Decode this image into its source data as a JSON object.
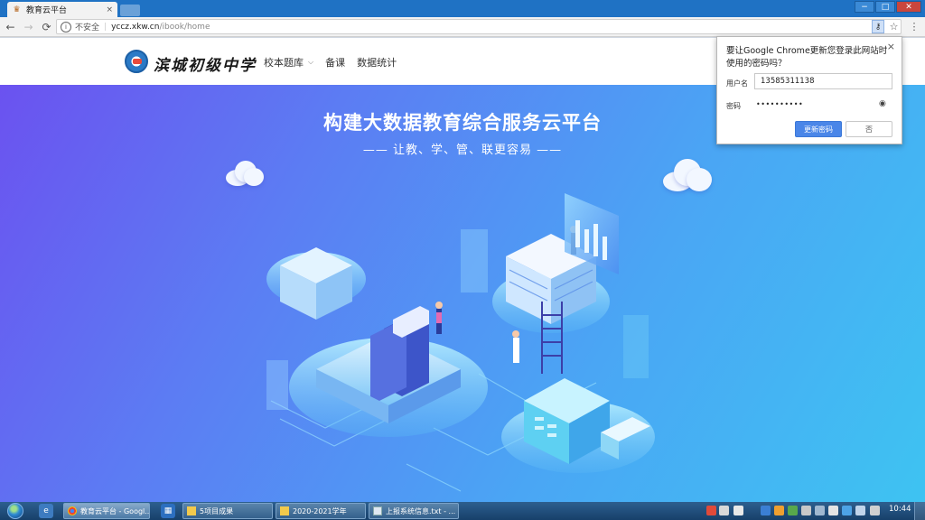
{
  "browser": {
    "tab_title": "教育云平台",
    "tab_close": "×",
    "window_controls": {
      "minimize": "−",
      "maximize": "□",
      "close": "✕"
    },
    "nav": {
      "back": "←",
      "forward": "→",
      "reload": "⟳"
    },
    "address": {
      "security_label": "不安全",
      "host": "yccz.xkw.cn",
      "path": "/ibook/home"
    }
  },
  "site": {
    "school_name": "滨城初级中学",
    "nav_items": [
      {
        "label": "校本题库",
        "has_dropdown": true
      },
      {
        "label": "备课"
      },
      {
        "label": "数据统计"
      }
    ]
  },
  "hero": {
    "title": "构建大数据教育综合服务云平台",
    "subtitle": "—— 让教、学、管、联更容易 ——"
  },
  "password_popup": {
    "title": "要让Google Chrome更新您登录此网站时使用的密码吗？",
    "username_label": "用户名",
    "username_value": "13585311138",
    "password_label": "密码",
    "password_value": "••••••••••",
    "update_button": "更新密码",
    "no_button": "否",
    "close": "×"
  },
  "taskbar": {
    "windows": [
      {
        "label": "教育云平台 - Googl...",
        "active": true
      },
      {
        "label": "5项目成果"
      },
      {
        "label": "2020-2021学年"
      },
      {
        "label": "上报系统信息.txt - ..."
      }
    ],
    "clock": "10:44"
  },
  "colors": {
    "hero_start": "#6b52f0",
    "hero_end": "#3ec3f2",
    "accent_button": "#4a86e8",
    "titlebar": "#1f72c4"
  }
}
